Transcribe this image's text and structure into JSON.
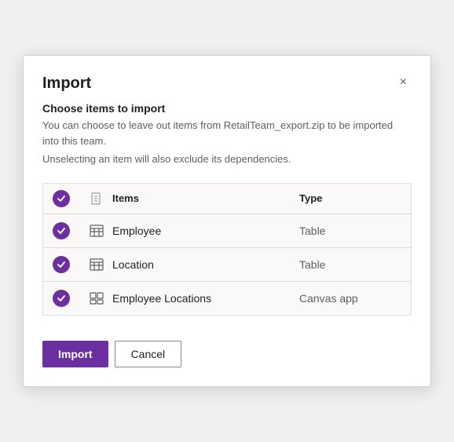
{
  "dialog": {
    "title": "Import",
    "subtitle": "Choose items to import",
    "description": "You can choose to leave out items from RetailTeam_export.zip to be imported into this team.",
    "description2": "Unselecting an item will also exclude its dependencies.",
    "close_label": "×"
  },
  "table": {
    "columns": {
      "items": "Items",
      "type": "Type"
    },
    "rows": [
      {
        "name": "Employee",
        "type": "Table",
        "icon": "table"
      },
      {
        "name": "Location",
        "type": "Table",
        "icon": "table"
      },
      {
        "name": "Employee Locations",
        "type": "Canvas app",
        "icon": "canvas"
      }
    ]
  },
  "footer": {
    "import_label": "Import",
    "cancel_label": "Cancel"
  }
}
